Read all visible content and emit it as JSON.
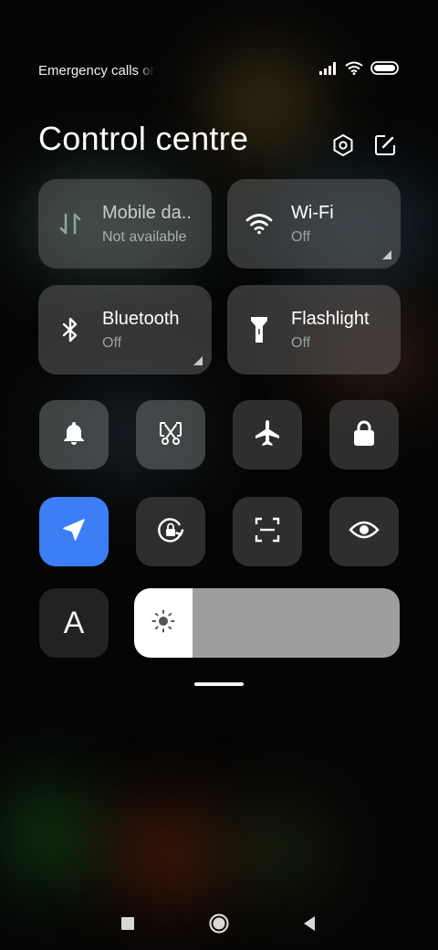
{
  "status_bar": {
    "text": "Emergency calls only",
    "icons": [
      "signal-icon",
      "wifi-icon",
      "battery-icon"
    ]
  },
  "header": {
    "title": "Control centre",
    "icons": [
      "settings-icon",
      "edit-icon"
    ]
  },
  "tiles": [
    {
      "label": "Mobile da..",
      "status": "Not available",
      "icon": "mobile-data-icon"
    },
    {
      "label": "Wi-Fi",
      "status": "Off",
      "icon": "wifi-icon"
    },
    {
      "label": "Bluetooth",
      "status": "Off",
      "icon": "bluetooth-icon"
    },
    {
      "label": "Flashlight",
      "status": "Off",
      "icon": "flashlight-icon"
    }
  ],
  "toggles_row1": [
    "bell-icon",
    "screenshot-icon",
    "airplane-icon",
    "lock-icon"
  ],
  "toggles_row2": [
    "location-icon",
    "rotation-lock-icon",
    "scanner-icon",
    "eye-icon"
  ],
  "reading_mode_label": "A",
  "brightness": {
    "icon": "sun-icon",
    "level": 0.22
  },
  "colors": {
    "accent": "#3d7ef6",
    "tile": "#6e6e6e",
    "brightness_track": "#9e9e9e"
  },
  "nav_bar": [
    "recents-icon",
    "home-icon",
    "back-icon"
  ]
}
